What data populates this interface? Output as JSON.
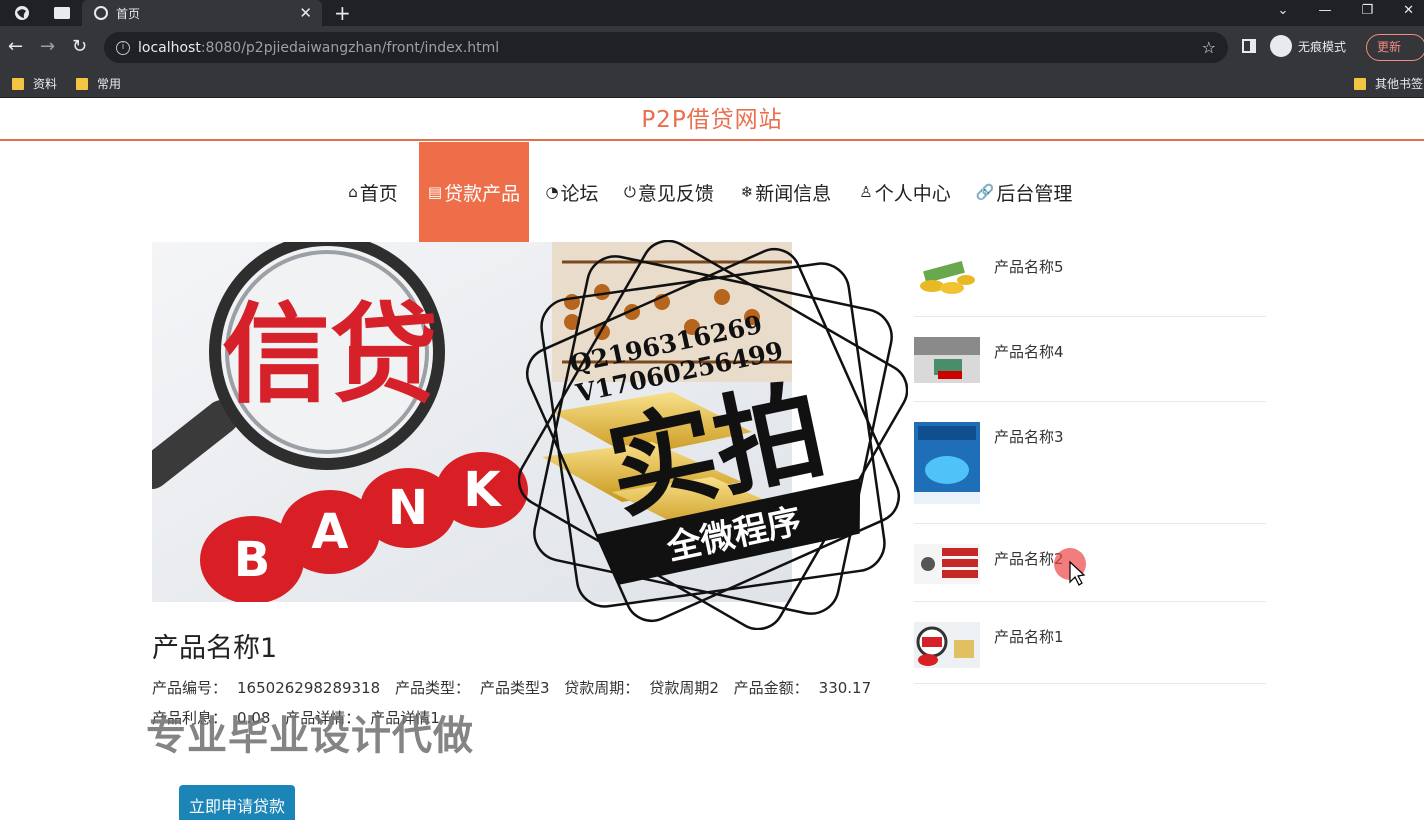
{
  "browser": {
    "tab_title": "首页",
    "url_host": "localhost",
    "url_path": ":8080/p2pjiedaiwangzhan/front/index.html",
    "incognito_label": "无痕模式",
    "update_label": "更新",
    "bookmarks": [
      "资料",
      "常用"
    ],
    "other_bookmarks": "其他书签"
  },
  "site": {
    "title": "P2P借贷网站",
    "nav": [
      {
        "icon": "home-icon",
        "label": "首页"
      },
      {
        "icon": "loan-product-icon",
        "label": "贷款产品"
      },
      {
        "icon": "forum-icon",
        "label": "论坛"
      },
      {
        "icon": "feedback-icon",
        "label": "意见反馈"
      },
      {
        "icon": "news-icon",
        "label": "新闻信息"
      },
      {
        "icon": "user-icon",
        "label": "个人中心"
      },
      {
        "icon": "link-icon",
        "label": "后台管理"
      }
    ],
    "active_nav": "贷款产品"
  },
  "banner": {
    "magnifier_text": "信贷",
    "coin_letters": [
      "B",
      "A",
      "N",
      "K"
    ]
  },
  "product": {
    "name": "产品名称1",
    "code_label": "产品编号：",
    "code": "165026298289318",
    "type_label": "产品类型：",
    "type": "产品类型3",
    "period_label": "贷款周期：",
    "period": "贷款周期2",
    "amount_label": "产品金额：",
    "amount": "330.17",
    "rate_label": "产品利息：",
    "rate": "0.08",
    "detail_label": "产品详情：",
    "detail": "产品详情1",
    "apply_label": "立即申请贷款"
  },
  "sidebar": {
    "items": [
      {
        "name": "产品名称5"
      },
      {
        "name": "产品名称4"
      },
      {
        "name": "产品名称3"
      },
      {
        "name": "产品名称2"
      },
      {
        "name": "产品名称1"
      }
    ]
  },
  "overlay": {
    "stamp_line1": "Q2196316269",
    "stamp_line2": "V17060256499",
    "stamp_big": "实拍",
    "stamp_ribbon": "全微程序",
    "watermark": "专业毕业设计代做"
  }
}
